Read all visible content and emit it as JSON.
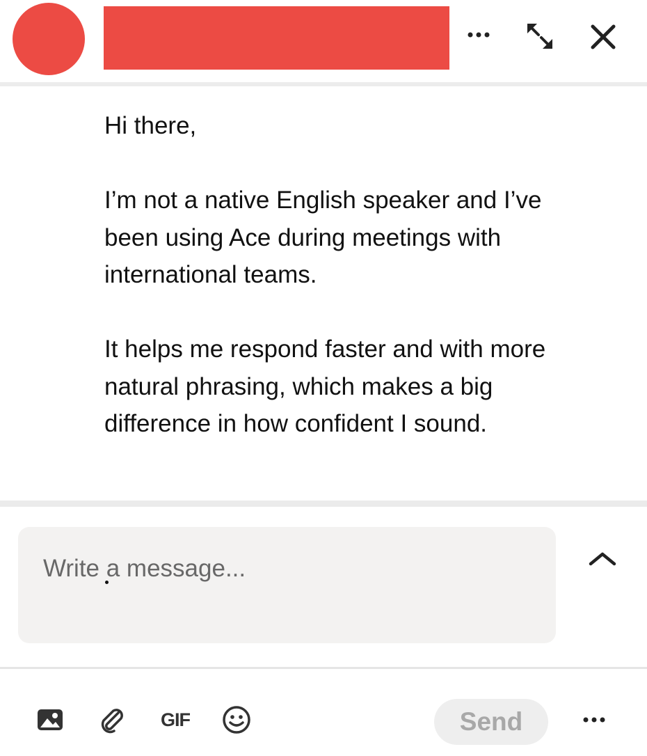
{
  "header": {
    "more_icon": "more-horizontal-icon",
    "expand_icon": "expand-icon",
    "close_icon": "close-icon"
  },
  "message": {
    "paragraphs": [
      "Hi there,",
      "I’m not a native English speaker and I’ve been using Ace during meetings with international teams.",
      "It helps me respond faster and with more natural phrasing, which makes a big difference in how confident I sound."
    ]
  },
  "composer": {
    "placeholder": "Write a message...",
    "value": "",
    "collapse_icon": "chevron-up-icon"
  },
  "toolbar": {
    "image_icon": "image-icon",
    "attach_icon": "paperclip-icon",
    "gif_label": "GIF",
    "emoji_icon": "emoji-icon",
    "send_label": "Send",
    "more_icon": "more-horizontal-icon"
  },
  "colors": {
    "redaction": "#ec4b44",
    "composer_bg": "#f3f2f1",
    "send_disabled_bg": "#eeeeee",
    "send_disabled_text": "#a8a8a8"
  }
}
